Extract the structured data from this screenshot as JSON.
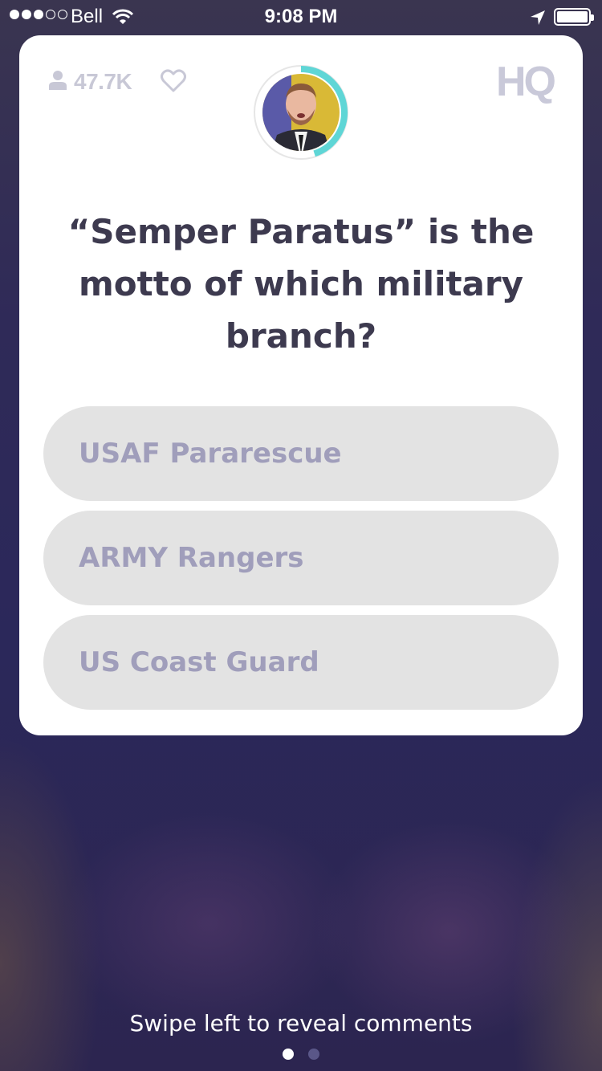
{
  "status_bar": {
    "carrier": "Bell",
    "time": "9:08 PM",
    "signal_icon": "signal-dots-icon",
    "wifi_icon": "wifi-icon",
    "location_icon": "location-arrow-icon",
    "battery_icon": "battery-icon"
  },
  "header": {
    "viewer_count": "47.7K",
    "viewer_icon": "person-icon",
    "like_icon": "heart-icon",
    "logo": "HQ",
    "timer_color": "#5fd6d6",
    "timer_fraction_elapsed": 0.45
  },
  "question": {
    "text": "“Semper Paratus” is the motto of which military branch?"
  },
  "answers": [
    {
      "label": "USAF Pararescue"
    },
    {
      "label": "ARMY Rangers"
    },
    {
      "label": "US Coast Guard"
    }
  ],
  "footer": {
    "swipe_hint": "Swipe left to reveal comments",
    "page_count": 2,
    "active_page": 1
  },
  "colors": {
    "card_bg": "#ffffff",
    "answer_bg": "#e3e3e3",
    "answer_text": "#a09ebb",
    "question_text": "#3d3a4f"
  }
}
